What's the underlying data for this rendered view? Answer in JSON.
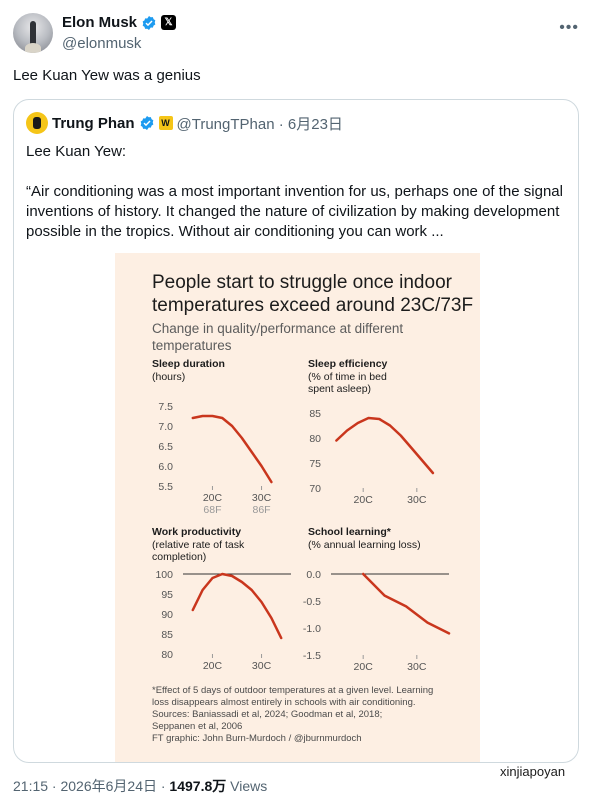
{
  "author": {
    "name": "Elon Musk",
    "handle": "@elonmusk"
  },
  "tweet": {
    "text": "Lee Kuan Yew was a genius"
  },
  "quote": {
    "name": "Trung Phan",
    "handle_date": "@TrungTPhan · 6月23日",
    "line1": "Lee Kuan Yew:",
    "line2": "“Air conditioning was a most important invention for us, perhaps one of the signal inventions of history. It changed the nature of civilization by making development possible in the tropics. Without air conditioning you can work ..."
  },
  "chart": {
    "title_line1": "People start to struggle once indoor",
    "title_line2": "temperatures exceed around 23C/73F",
    "subtitle_line1": "Change in quality/performance at different",
    "subtitle_line2": "temperatures",
    "footnote": [
      "*Effect of 5 days of outdoor temperatures at a given level. Learning",
      "loss disappears almost entirely in schools with air conditioning.",
      "Sources: Baniassadi et al, 2024; Goodman et al, 2018;",
      "Seppanen et al, 2006",
      "FT graphic: John Burn-Murdoch / @jburnmurdoch"
    ]
  },
  "chart_data": [
    {
      "type": "line",
      "title": "Sleep duration",
      "subtitle": [
        "(hours)"
      ],
      "x_ticks": [
        "20C",
        "30C"
      ],
      "x_ticks_sub": [
        "68F",
        "86F"
      ],
      "y_ticks": [
        "7.5",
        "7.0",
        "6.5",
        "6.0",
        "5.5"
      ],
      "ylim": [
        5.5,
        7.5
      ],
      "x": [
        16,
        18,
        20,
        22,
        24,
        26,
        28,
        30,
        32
      ],
      "y": [
        7.2,
        7.25,
        7.25,
        7.2,
        7.0,
        6.7,
        6.35,
        6.0,
        5.6
      ],
      "color": "#c9361d"
    },
    {
      "type": "line",
      "title": "Sleep efficiency",
      "subtitle": [
        "(% of time in bed",
        "spent asleep)"
      ],
      "x_ticks": [
        "20C",
        "30C"
      ],
      "y_ticks": [
        "85",
        "80",
        "75",
        "70"
      ],
      "ylim": [
        70,
        85
      ],
      "x": [
        15,
        17,
        19,
        21,
        23,
        25,
        27,
        29,
        31,
        33
      ],
      "y": [
        79.5,
        81.5,
        83,
        84,
        83.8,
        82.5,
        80.5,
        78,
        75.5,
        73
      ],
      "color": "#c9361d"
    },
    {
      "type": "line",
      "title": "Work productivity",
      "subtitle": [
        "(relative rate of task",
        "completion)"
      ],
      "x_ticks": [
        "20C",
        "30C"
      ],
      "y_ticks": [
        "100",
        "95",
        "90",
        "85",
        "80"
      ],
      "ylim": [
        80,
        100
      ],
      "reference_line": 100,
      "x": [
        16,
        18,
        20,
        22,
        24,
        26,
        28,
        30,
        32,
        34
      ],
      "y": [
        91,
        96,
        99,
        100,
        99.5,
        98,
        96,
        93,
        89,
        84
      ],
      "color": "#c9361d"
    },
    {
      "type": "line",
      "title": "School learning*",
      "subtitle": [
        "(% annual learning loss)"
      ],
      "x_ticks": [
        "20C",
        "30C"
      ],
      "y_ticks": [
        "0.0",
        "-0.5",
        "-1.0",
        "-1.5"
      ],
      "ylim": [
        -1.5,
        0.0
      ],
      "reference_line": 0,
      "x": [
        20,
        24,
        28,
        32,
        36
      ],
      "y": [
        0.0,
        -0.4,
        -0.6,
        -0.9,
        -1.1
      ],
      "color": "#c9361d"
    }
  ],
  "footer": {
    "time_date": "21:15 · 2026年6月24日 · ",
    "views_count": "1497.8万",
    "views_label": " Views"
  },
  "watermark": "xinjiapoyan",
  "icons": {
    "verified": "verified-badge-icon",
    "x": "x-logo-icon",
    "more": "more-options-icon"
  },
  "colors": {
    "accent": "#1d9bf0",
    "line": "#c9361d",
    "chart_bg": "#fdefe3"
  }
}
